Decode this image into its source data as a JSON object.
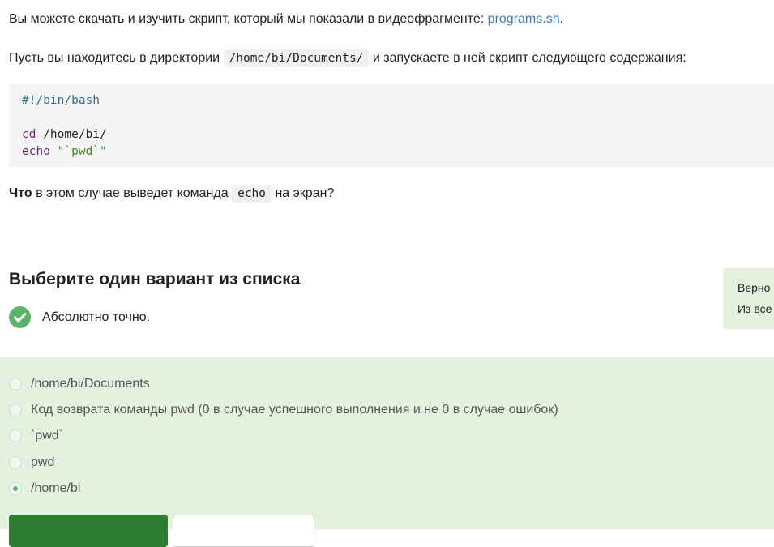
{
  "intro": {
    "download_text": "Вы можете скачать и изучить скрипт, который мы показали в видеофрагменте: ",
    "download_link": "programs.sh",
    "download_end": ".",
    "context_text_1": "Пусть вы находитесь в директории ",
    "context_code": "/home/bi/Documents/",
    "context_text_2": " и запускаете в ней скрипт следующего содержания:"
  },
  "code": {
    "shebang": "#!/bin/bash",
    "cd_cmd": "cd",
    "cd_arg": " /home/bi/",
    "echo_cmd": "echo",
    "echo_arg": " \"`pwd`\""
  },
  "question": {
    "bold": "Что",
    "text_1": " в этом случае выведет команда ",
    "code": "echo",
    "text_2": " на экран?"
  },
  "quiz": {
    "title": "Выберите один вариант из списка",
    "status_icon": "check-circle-icon",
    "status_text": "Абсолютно точно.",
    "hint_line_1": "Верно",
    "hint_line_2": "Из все",
    "options": [
      {
        "label": "/home/bi/Documents",
        "selected": false
      },
      {
        "label": "Код возврата команды pwd (0 в случае успешного выполнения и не 0 в случае ошибок)",
        "selected": false
      },
      {
        "label": "`pwd`",
        "selected": false
      },
      {
        "label": "pwd",
        "selected": false
      },
      {
        "label": "/home/bi",
        "selected": true
      }
    ]
  },
  "colors": {
    "accent_green": "#5bb369",
    "primary_button": "#2f7d32",
    "answer_background": "#e3f1de",
    "link": "#3d7fb5"
  }
}
